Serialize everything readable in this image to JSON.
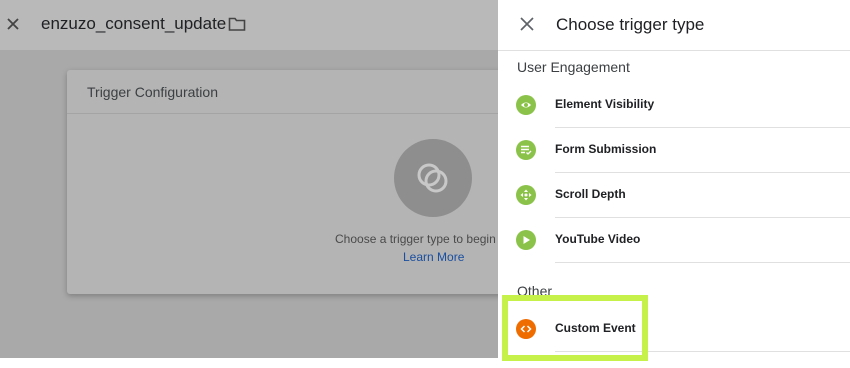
{
  "header": {
    "title": "enzuzo_consent_update"
  },
  "trigger_card": {
    "title": "Trigger Configuration",
    "hint": "Choose a trigger type to begin s",
    "learn_more": "Learn More"
  },
  "panel": {
    "title": "Choose trigger type",
    "sections": [
      {
        "label": "User Engagement",
        "items": [
          {
            "label": "Element Visibility",
            "icon": "eye-icon",
            "color": "#8bc34a"
          },
          {
            "label": "Form Submission",
            "icon": "form-icon",
            "color": "#8bc34a"
          },
          {
            "label": "Scroll Depth",
            "icon": "move-arrows-icon",
            "color": "#8bc34a"
          },
          {
            "label": "YouTube Video",
            "icon": "play-icon",
            "color": "#8bc34a"
          }
        ]
      },
      {
        "label": "Other",
        "items": [
          {
            "label": "Custom Event",
            "icon": "code-icon",
            "color": "#ef6c00"
          }
        ]
      }
    ]
  },
  "colors": {
    "highlight": "#c6f04a",
    "overlay": "#a9a9a9"
  }
}
